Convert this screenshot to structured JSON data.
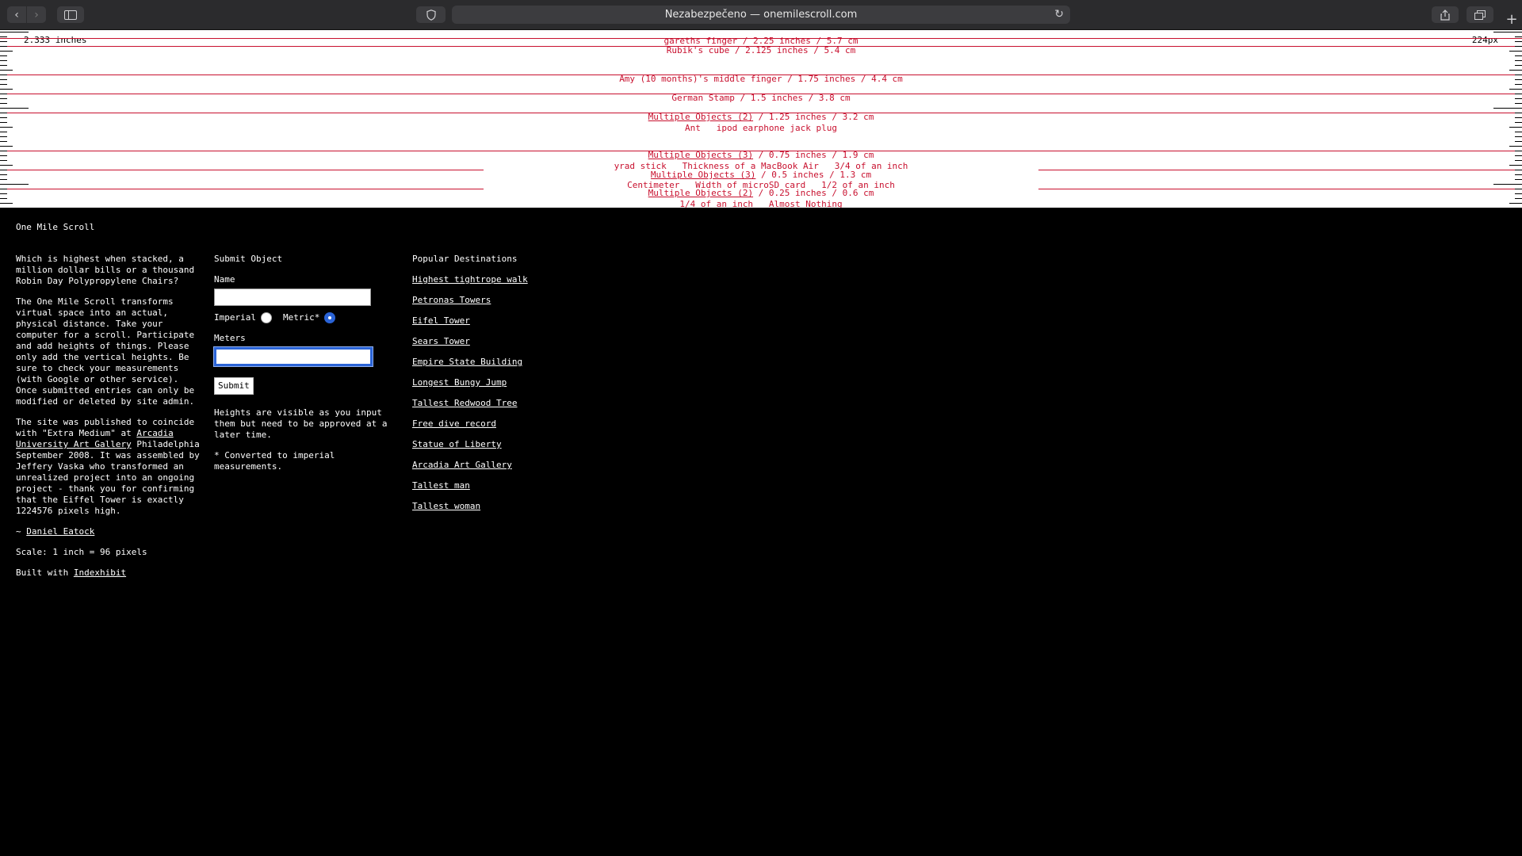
{
  "toolbar": {
    "address": "Nezabezpečeno — onemilescroll.com",
    "icons": {
      "back": "chevron-left-icon",
      "forward": "chevron-right-icon",
      "sidebar": "sidebar-icon",
      "shield": "shield-icon",
      "reload": "reload-icon",
      "share": "share-icon",
      "tabs": "tabs-icon",
      "new_tab": "plus-icon"
    }
  },
  "ruler": {
    "inch_readout": "2.333 inches",
    "px_readout": "224px",
    "labels": [
      {
        "text": "gareths finger / 2.25 inches / 5.7 cm"
      },
      {
        "text": "Rubik's cube / 2.125 inches / 5.4 cm"
      },
      {
        "text": "Amy (10 months)'s middle finger / 1.75 inches / 4.4 cm"
      },
      {
        "text": "German Stamp / 1.5 inches / 3.8 cm"
      },
      {
        "link": "Multiple Objects (2)",
        "text": " / 1.25 inches / 3.2 cm"
      },
      {
        "text": "Ant   ipod earphone jack plug"
      },
      {
        "link": "Multiple Objects (3)",
        "text": " / 0.75 inches / 1.9 cm"
      },
      {
        "text": "yrad stick   Thickness of a MacBook Air   3/4 of an inch"
      },
      {
        "link": "Multiple Objects (3)",
        "text": " / 0.5 inches / 1.3 cm"
      },
      {
        "text": "Centimeter   Width of microSD card   1/2 of an inch"
      },
      {
        "link": "Multiple Objects (2)",
        "text": " / 0.25 inches / 0.6 cm"
      },
      {
        "text": "1/4 of an inch   Almost Nothing"
      }
    ]
  },
  "site": {
    "title": "One Mile Scroll",
    "about": {
      "p1": "Which is highest when stacked, a million dollar bills or a thousand Robin Day Polypropylene Chairs?",
      "p2": "The One Mile Scroll transforms virtual space into an actual, physical distance. Take your computer for a scroll. Participate and add heights of things. Please only add the vertical heights. Be sure to check your measurements (with Google or other service). Once submitted entries can only be modified or deleted by site admin.",
      "p3_before": "The site was published to coincide with \"Extra Medium\" at ",
      "p3_link": "Arcadia University Art Gallery",
      "p3_after": " Philadelphia September 2008. It was assembled by Jeffery Vaska who transformed an unrealized project into an ongoing project - thank you for confirming that the Eiffel Tower is exactly 1224576 pixels high.",
      "author_prefix": "~ ",
      "author_link": "Daniel Eatock",
      "scale": "Scale: 1 inch = 96 pixels",
      "built_prefix": "Built with ",
      "built_link": "Indexhibit"
    },
    "submit": {
      "heading": "Submit Object",
      "name_label": "Name",
      "imperial_label": "Imperial",
      "metric_label": "Metric*",
      "meters_label": "Meters",
      "submit_label": "Submit",
      "note1": "Heights are visible as you input them but need to be approved at a later time.",
      "note2": "* Converted to imperial measurements."
    },
    "popular": {
      "heading": "Popular Destinations",
      "links": [
        "Highest tightrope walk",
        "Petronas Towers",
        "Eifel Tower",
        "Sears Tower",
        "Empire State Building",
        "Longest Bungy Jump",
        "Tallest Redwood Tree",
        "Free dive record",
        "Statue of Liberty",
        "Arcadia Art Gallery",
        "Tallest man",
        "Tallest woman"
      ]
    }
  }
}
